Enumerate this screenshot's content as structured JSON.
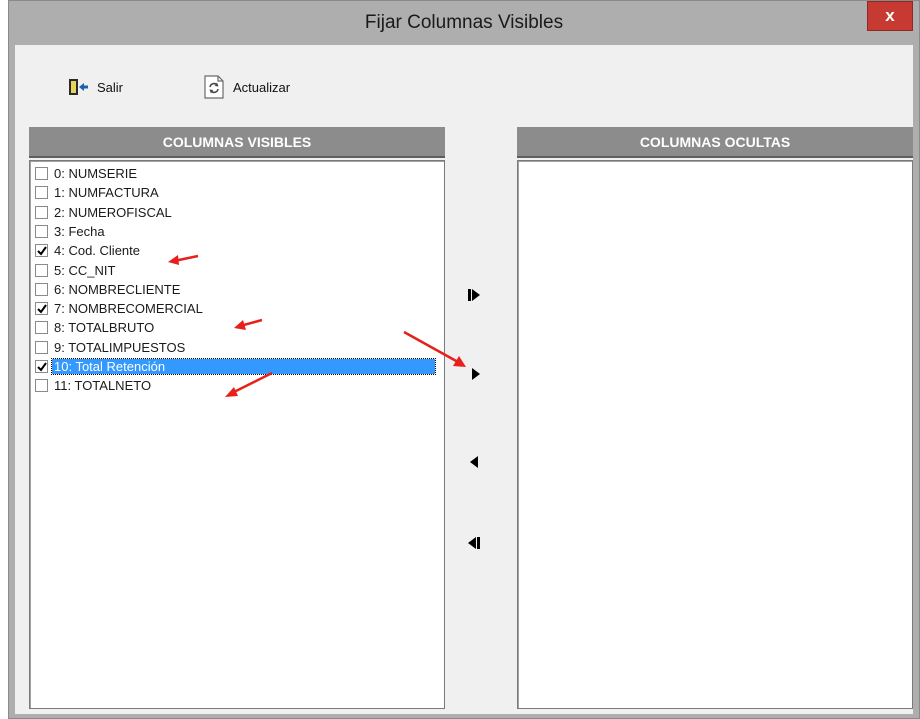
{
  "window": {
    "title": "Fijar Columnas Visibles",
    "close_label": "x"
  },
  "toolbar": {
    "salir_label": "Salir",
    "actualizar_label": "Actualizar"
  },
  "left_panel": {
    "header": "COLUMNAS VISIBLES",
    "items": [
      {
        "label": "0: NUMSERIE",
        "checked": false,
        "selected": false
      },
      {
        "label": "1: NUMFACTURA",
        "checked": false,
        "selected": false
      },
      {
        "label": "2: NUMEROFISCAL",
        "checked": false,
        "selected": false
      },
      {
        "label": "3: Fecha",
        "checked": false,
        "selected": false
      },
      {
        "label": "4: Cod. Cliente",
        "checked": true,
        "selected": false
      },
      {
        "label": "5: CC_NIT",
        "checked": false,
        "selected": false
      },
      {
        "label": "6: NOMBRECLIENTE",
        "checked": false,
        "selected": false
      },
      {
        "label": "7: NOMBRECOMERCIAL",
        "checked": true,
        "selected": false
      },
      {
        "label": "8: TOTALBRUTO",
        "checked": false,
        "selected": false
      },
      {
        "label": "9: TOTALIMPUESTOS",
        "checked": false,
        "selected": false
      },
      {
        "label": "10: Total Retención",
        "checked": true,
        "selected": true
      },
      {
        "label": "11: TOTALNETO",
        "checked": false,
        "selected": false
      }
    ]
  },
  "right_panel": {
    "header": "COLUMNAS OCULTAS",
    "items": []
  },
  "move_buttons": [
    {
      "icon": "move-all-right-icon"
    },
    {
      "icon": "move-right-icon"
    },
    {
      "icon": "move-left-icon"
    },
    {
      "icon": "move-all-left-icon"
    }
  ],
  "colors": {
    "header_bg": "#8c8c8c",
    "selection": "#3399ff",
    "close_button": "#c73a31",
    "annotation_arrow": "#e8201c"
  }
}
